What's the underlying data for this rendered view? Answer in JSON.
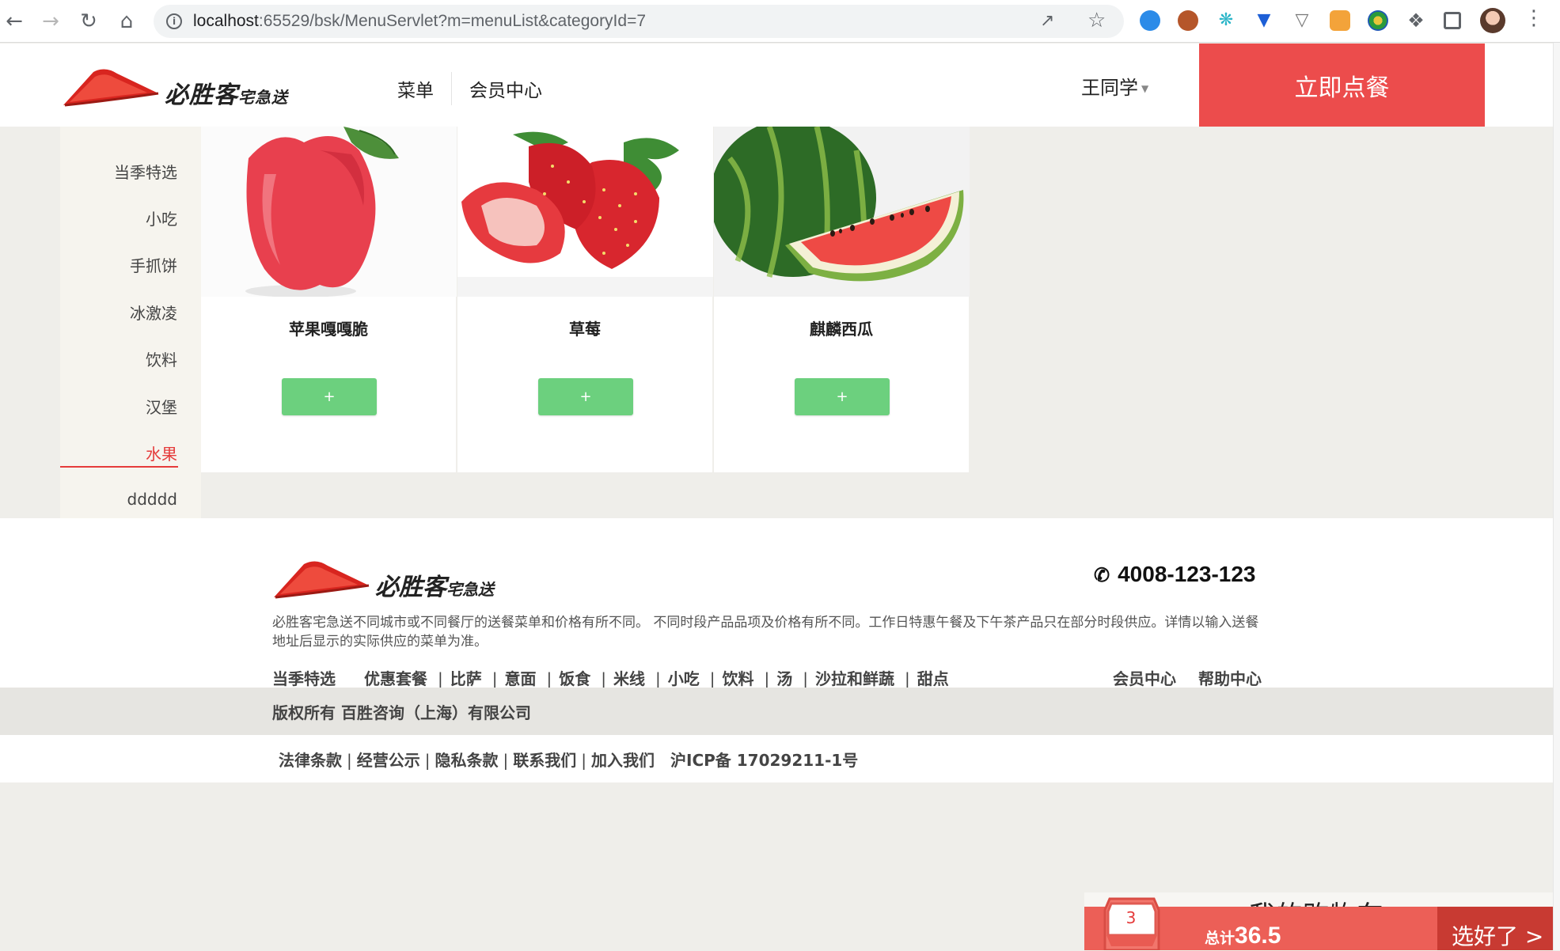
{
  "browser": {
    "url_host": "localhost",
    "url_path": ":65529/bsk/MenuServlet?m=menuList&categoryId=7"
  },
  "header": {
    "logo_text": "必胜客",
    "logo_subtext": "宅急送",
    "nav": [
      "菜单",
      "会员中心"
    ],
    "user_name": "王同学",
    "order_button": "立即点餐"
  },
  "sidebar": {
    "categories": [
      "当季特选",
      "小吃",
      "手抓饼",
      "冰激凌",
      "饮料",
      "汉堡",
      "水果",
      "ddddd"
    ],
    "active": "水果"
  },
  "products": [
    {
      "name": "苹果嘎嘎脆",
      "button": "+"
    },
    {
      "name": "草莓",
      "button": "+"
    },
    {
      "name": "麒麟西瓜",
      "button": "+"
    }
  ],
  "footer": {
    "logo_text": "必胜客",
    "logo_subtext": "宅急送",
    "hotline": "4008-123-123",
    "disclaimer": "必胜客宅急送不同城市或不同餐厅的送餐菜单和价格有所不同。 不同时段产品品项及价格有所不同。工作日特惠午餐及下午茶产品只在部分时段供应。详情以输入送餐地址后显示的实际供应的菜单为准。",
    "links": [
      "当季特选",
      "优惠套餐",
      "比萨",
      "意面",
      "饭食",
      "米线",
      "小吃",
      "饮料",
      "汤",
      "沙拉和鲜蔬",
      "甜点"
    ],
    "right_links": [
      "会员中心",
      "帮助中心"
    ],
    "copyright": "版权所有 百胜咨询（上海）有限公司",
    "legal_links": [
      "法律条款",
      "经营公示",
      "隐私条款",
      "联系我们",
      "加入我们"
    ],
    "icp": "沪ICP备 17029211-1号"
  },
  "cart": {
    "title": "我的购物车",
    "count": "3",
    "total_label": "总计",
    "total_value": "36.5",
    "checkout": "选好了 >"
  },
  "colors": {
    "brand_red": "#ec4c4c",
    "add_green": "#6cd07e",
    "active_red": "#e53b3b"
  }
}
